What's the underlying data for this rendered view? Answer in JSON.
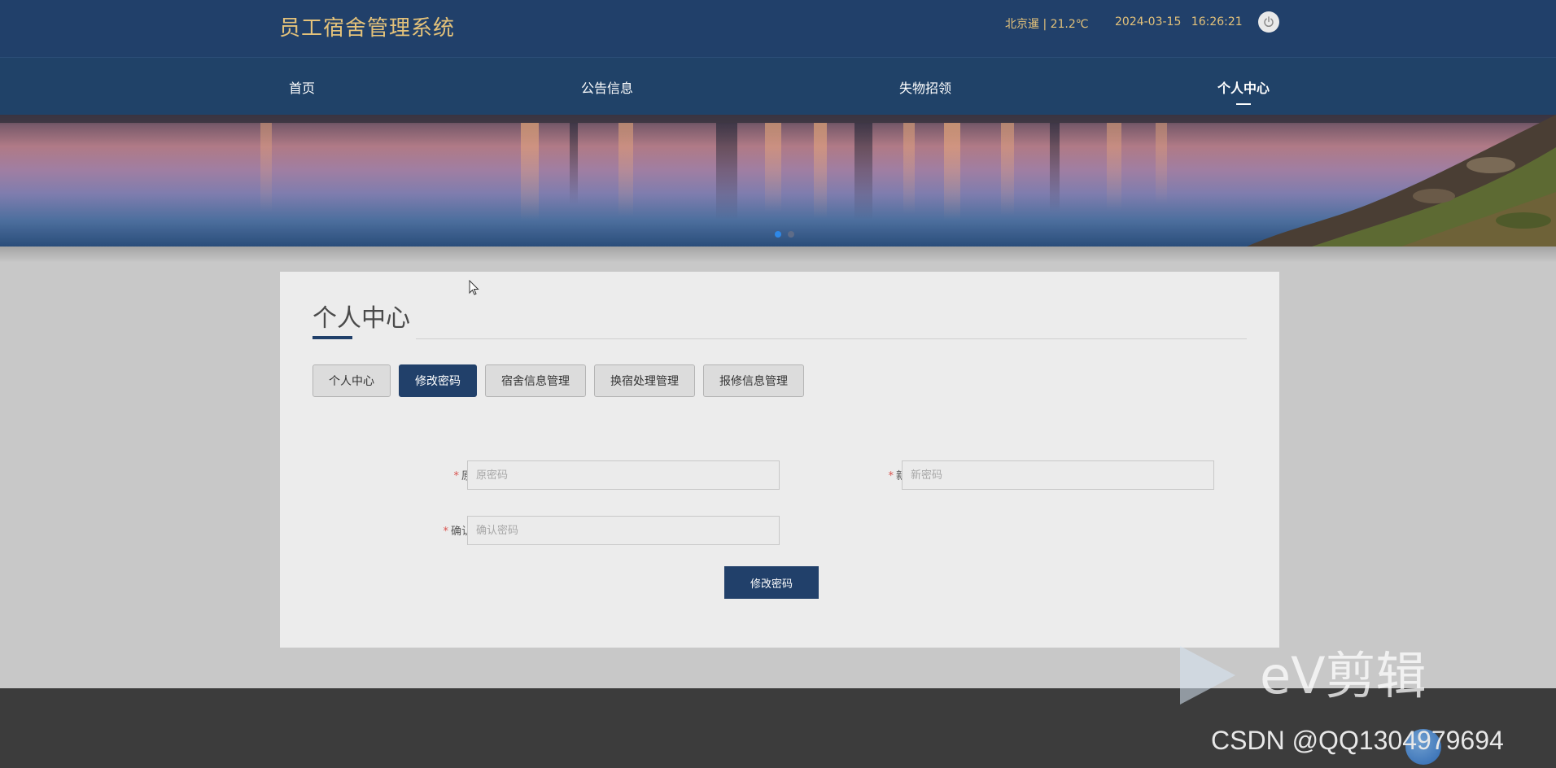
{
  "header": {
    "site_title": "员工宿舍管理系统",
    "weather": "北京暹 | 21.2℃",
    "datetime": "2024-03-15   16:26:21",
    "power_icon": "power-icon"
  },
  "nav": {
    "items": [
      {
        "label": "首页"
      },
      {
        "label": "公告信息"
      },
      {
        "label": "失物招领"
      },
      {
        "label": "个人中心"
      }
    ],
    "active": "个人中心"
  },
  "banner": {
    "slide_count": 2,
    "active_slide": 1
  },
  "card": {
    "title": "个人中心",
    "tabs": [
      {
        "label": "个人中心"
      },
      {
        "label": "修改密码"
      },
      {
        "label": "宿舍信息管理"
      },
      {
        "label": "换宿处理管理"
      },
      {
        "label": "报修信息管理"
      }
    ],
    "active_tab": "修改密码",
    "form": {
      "required_mark": "*",
      "old_password": {
        "label": "原密码",
        "placeholder": "原密码",
        "value": ""
      },
      "new_password": {
        "label": "新密码",
        "placeholder": "新密码",
        "value": ""
      },
      "confirm_password": {
        "label": "确认密码",
        "placeholder": "确认密码",
        "value": ""
      },
      "submit_label": "修改密码"
    }
  },
  "watermarks": {
    "ev_text": "eV剪辑",
    "csdn": "CSDN @QQ1304979694"
  },
  "colors": {
    "primary": "#21406a",
    "title_gold": "#e4c27a",
    "required": "#d9534f"
  }
}
